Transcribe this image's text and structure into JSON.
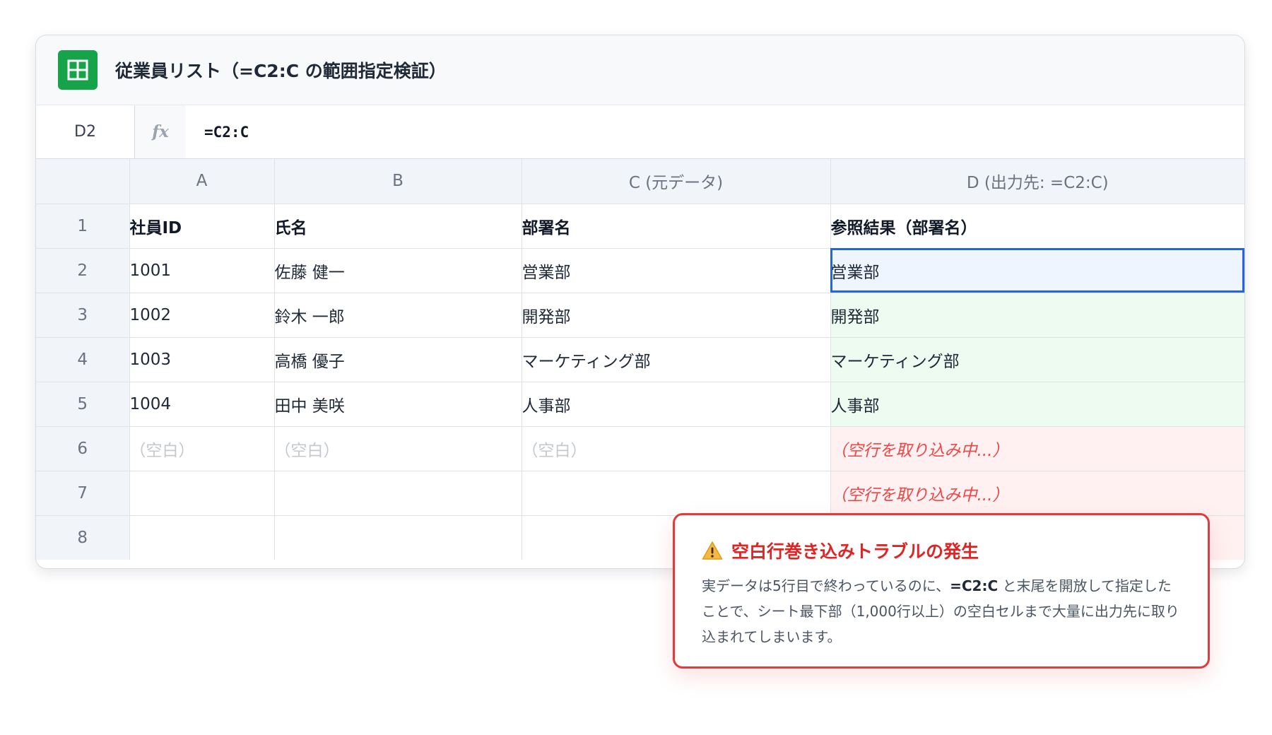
{
  "app": {
    "title": "従業員リスト（=C2:C の範囲指定検証）",
    "icon": "sheets-grid-icon",
    "accent": "#16a34a"
  },
  "formula_bar": {
    "cell_ref": "D2",
    "fx_label": "fx",
    "formula": "=C2:C"
  },
  "columns": [
    "A",
    "B",
    "C (元データ)",
    "D (出力先: =C2:C)"
  ],
  "rows": [
    {
      "num": "1",
      "cells": [
        "社員ID",
        "氏名",
        "部署名",
        "参照結果（部署名）"
      ]
    },
    {
      "num": "2",
      "cells": [
        "1001",
        "佐藤 健一",
        "営業部",
        "営業部"
      ]
    },
    {
      "num": "3",
      "cells": [
        "1002",
        "鈴木 一郎",
        "開発部",
        "開発部"
      ]
    },
    {
      "num": "4",
      "cells": [
        "1003",
        "高橋 優子",
        "マーケティング部",
        "マーケティング部"
      ]
    },
    {
      "num": "5",
      "cells": [
        "1004",
        "田中 美咲",
        "人事部",
        "人事部"
      ]
    },
    {
      "num": "6",
      "cells": [
        "（空白）",
        "（空白）",
        "（空白）",
        "（空行を取り込み中...）"
      ]
    },
    {
      "num": "7",
      "cells": [
        "",
        "",
        "",
        "（空行を取り込み中...）"
      ]
    },
    {
      "num": "8",
      "cells": [
        "",
        "",
        "",
        ""
      ]
    }
  ],
  "selected_cell": "D2",
  "colors": {
    "selection": "#2563eb",
    "ok_fill": "#eefbf1",
    "warn_fill": "#fff1f1",
    "warn_text": "#ef4444",
    "alert_border": "#e23b3b"
  },
  "alert": {
    "icon": "warning-icon",
    "title": "空白行巻き込みトラブルの発生",
    "body_1": "実データは5行目で終わっているのに、",
    "body_formula": "=C2:C",
    "body_2": " と末尾を開放して指定したことで、シート最下部（1,000行以上）の空白セルまで大量に出力先に取り込まれてしまいます。"
  }
}
